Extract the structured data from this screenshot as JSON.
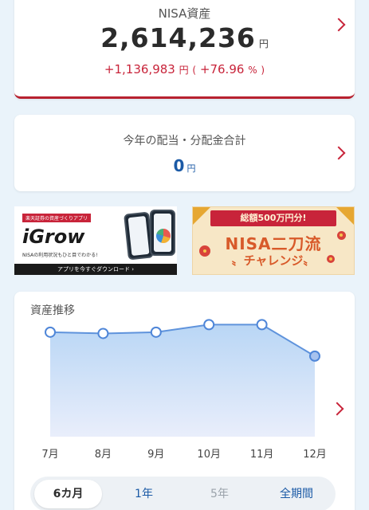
{
  "nisa": {
    "label": "NISA資産",
    "amount": "2,614,236",
    "unit": "円",
    "gain_amount": "+1,136,983",
    "gain_unit": "円",
    "gain_pct_open": "(",
    "gain_pct": "+76.96",
    "gain_pct_unit": "%",
    "gain_pct_close": ")"
  },
  "dividends": {
    "label": "今年の配当・分配金合計",
    "value": "0",
    "unit": "円"
  },
  "banners": {
    "igrow": {
      "tag": "楽天証券の資産づくりアプリ",
      "logo": "iGrow",
      "subtitle": "NISAの利用状況もひと目でわかる!",
      "cta": "アプリを今すぐダウンロード ›"
    },
    "campaign": {
      "ribbon": "総額500万円分!",
      "title": "NISA二刀流",
      "title2": "〟チャレンジ〟"
    }
  },
  "asset_chart": {
    "label": "資産推移"
  },
  "chart_data": {
    "type": "area",
    "title": "資産推移",
    "categories": [
      "7月",
      "8月",
      "9月",
      "10月",
      "11月",
      "12月"
    ],
    "series": [
      {
        "values": [
          0.83,
          0.82,
          0.83,
          0.89,
          0.89,
          0.64
        ]
      }
    ],
    "ylim": [
      0,
      1
    ],
    "grid": false,
    "colors": {
      "line": "#5f93dc",
      "fill_top": "#b9d6f5",
      "fill_bottom": "#e9eefb",
      "marker_stroke": "#4f86d8"
    }
  },
  "tabs": [
    {
      "label": "6カ月",
      "state": "selected"
    },
    {
      "label": "1年",
      "state": "link"
    },
    {
      "label": "5年",
      "state": "disabled"
    },
    {
      "label": "全期間",
      "state": "link"
    }
  ],
  "colors": {
    "accent_red": "#c8243a",
    "accent_blue": "#1b5aa6",
    "background": "#eaf3fa"
  }
}
